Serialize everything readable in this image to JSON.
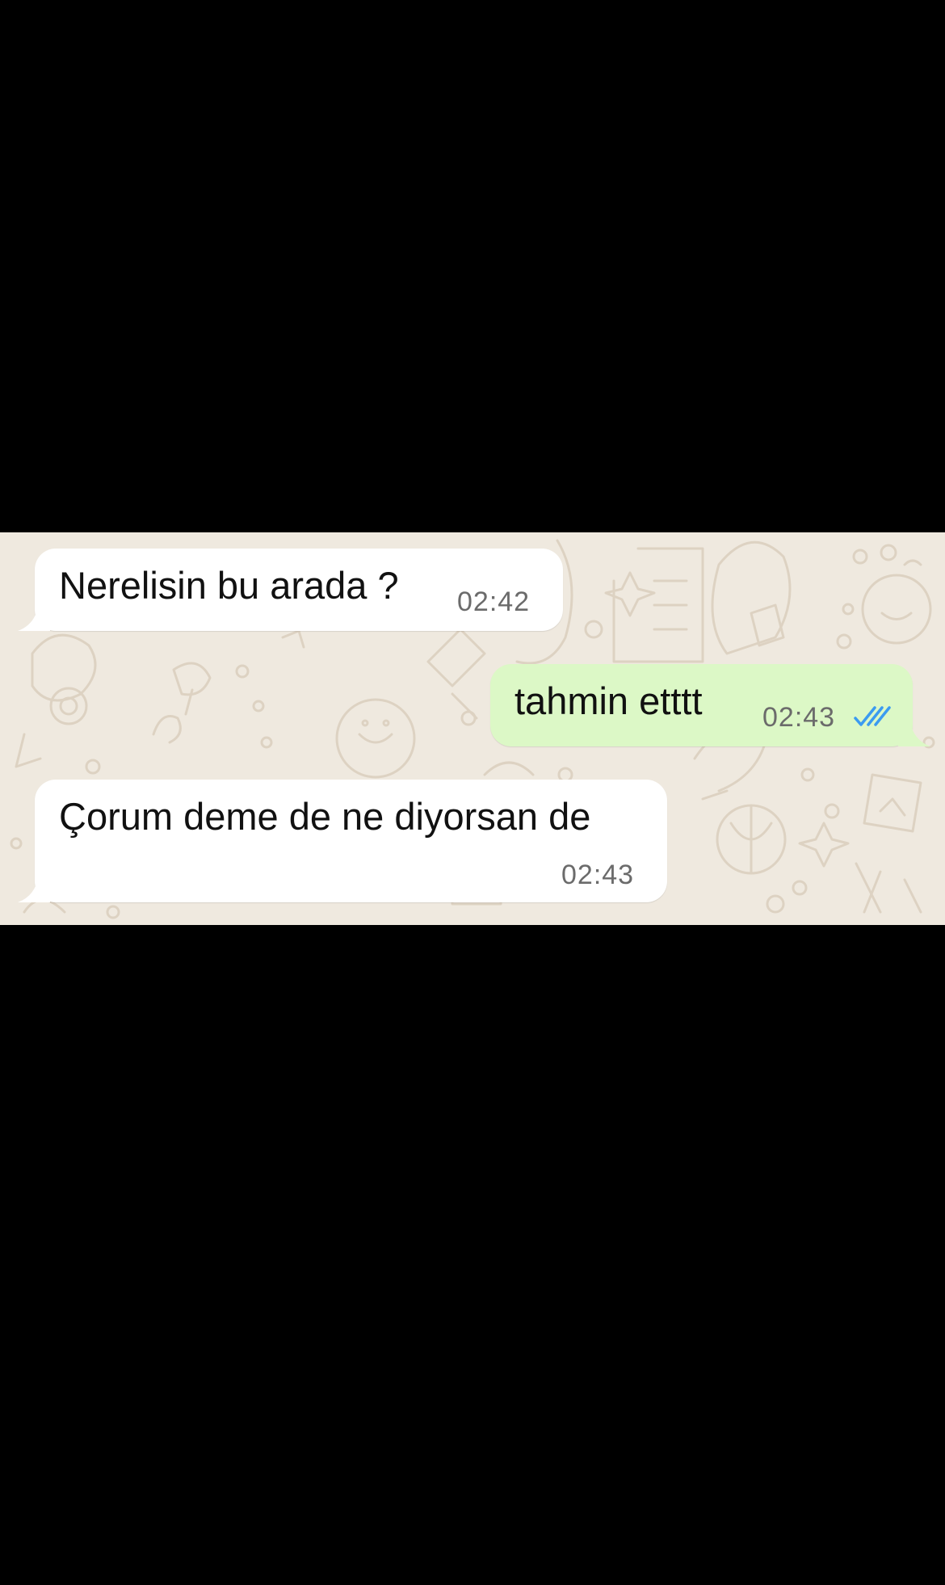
{
  "chat": {
    "messages": [
      {
        "direction": "incoming",
        "text": "Nerelisin bu arada ?",
        "time": "02:42"
      },
      {
        "direction": "outgoing",
        "text": "tahmin etttt",
        "time": "02:43",
        "status_icon": "double-check-read-icon"
      },
      {
        "direction": "incoming",
        "text": "Çorum deme de ne diyorsan de",
        "time": "02:43"
      }
    ]
  },
  "colors": {
    "letterbox": "#000000",
    "wallpaper": "#efe9df",
    "incoming_bubble": "#ffffff",
    "outgoing_bubble": "#dcf8c6",
    "read_ticks": "#3b9bf0",
    "time_text": "#6b6b6b"
  }
}
